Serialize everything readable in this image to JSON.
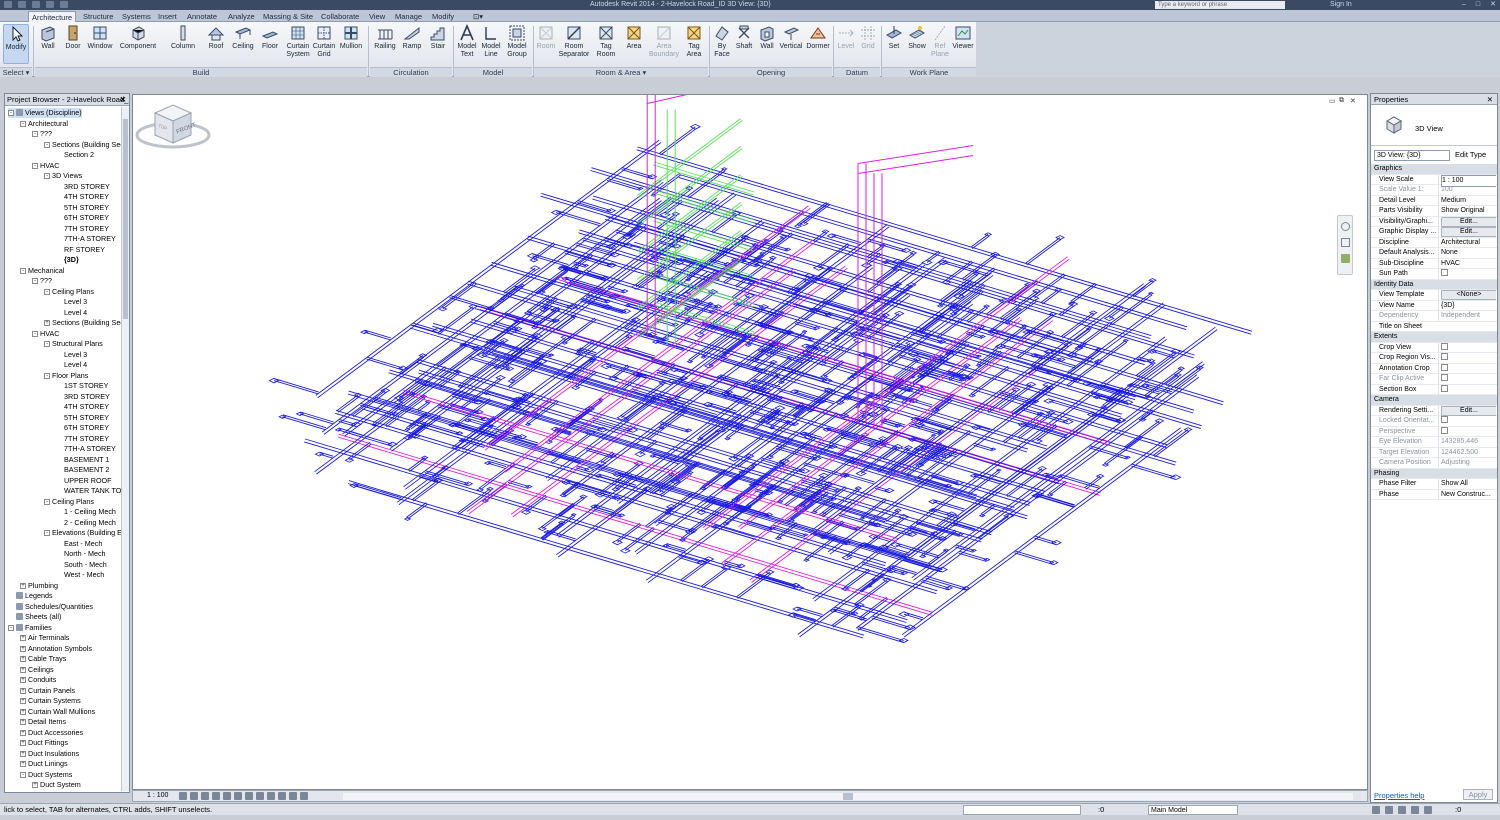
{
  "titlebar": {
    "doc_title": "Autodesk Revit 2014 - 2-Havelock Road_ID 3D View: {3D}",
    "search_placeholder": "Type a keyword or phrase",
    "signin": "Sign In",
    "win_min": "–",
    "win_max": "□",
    "win_close": "✕"
  },
  "ribbon_tabs": [
    "Architecture",
    "Structure",
    "Systems",
    "Insert",
    "Annotate",
    "Analyze",
    "Massing & Site",
    "Collaborate",
    "View",
    "Manage",
    "Modify"
  ],
  "ribbon_tab_extra": "⊡▾",
  "ribbon": {
    "modify": "Modify",
    "select": "Select ▾",
    "build_label": "Build",
    "circulation_label": "Circulation",
    "model_label": "Model",
    "room_area_label": "Room & Area ▾",
    "opening_label": "Opening",
    "datum_label": "Datum",
    "work_plane_label": "Work Plane",
    "buttons": {
      "wall": "Wall",
      "door": "Door",
      "window": "Window",
      "component": "Component",
      "column": "Column",
      "roof": "Roof",
      "ceiling": "Ceiling",
      "floor": "Floor",
      "curtain_system_1": "Curtain",
      "curtain_system_2": "System",
      "curtain_grid_1": "Curtain",
      "curtain_grid_2": "Grid",
      "mullion": "Mullion",
      "railing": "Railing",
      "ramp": "Ramp",
      "stair": "Stair",
      "model_text_1": "Model",
      "model_text_2": "Text",
      "model_line_1": "Model",
      "model_line_2": "Line",
      "model_group_1": "Model",
      "model_group_2": "Group",
      "room": "Room",
      "room_separator_1": "Room",
      "room_separator_2": "Separator",
      "tag_room_1": "Tag",
      "tag_room_2": "Room",
      "area": "Area",
      "area_boundary_1": "Area",
      "area_boundary_2": "Boundary",
      "tag_area_1": "Tag",
      "tag_area_2": "Area",
      "by_face_1": "By",
      "by_face_2": "Face",
      "shaft": "Shaft",
      "wall_opening": "Wall",
      "vertical": "Vertical",
      "dormer": "Dormer",
      "level": "Level",
      "grid": "Grid",
      "set": "Set",
      "show": "Show",
      "ref_plane_1": "Ref",
      "ref_plane_2": "Plane",
      "viewer": "Viewer"
    }
  },
  "browser": {
    "title": "Project Browser - 2-Havelock Road_...",
    "close": "✕",
    "nodes": [
      {
        "label": "Views (Discipline)",
        "depth": 0,
        "exp": "-",
        "sel": true,
        "icon": true
      },
      {
        "label": "Architectural",
        "depth": 1,
        "exp": "-"
      },
      {
        "label": "???",
        "depth": 2,
        "exp": "-"
      },
      {
        "label": "Sections (Building Sec",
        "depth": 3,
        "exp": "-"
      },
      {
        "label": "Section 2",
        "depth": 4,
        "exp": ""
      },
      {
        "label": "HVAC",
        "depth": 2,
        "exp": "-"
      },
      {
        "label": "3D Views",
        "depth": 3,
        "exp": "-"
      },
      {
        "label": "3RD STOREY",
        "depth": 4,
        "exp": ""
      },
      {
        "label": "4TH STOREY",
        "depth": 4,
        "exp": ""
      },
      {
        "label": "5TH STOREY",
        "depth": 4,
        "exp": ""
      },
      {
        "label": "6TH STOREY",
        "depth": 4,
        "exp": ""
      },
      {
        "label": "7TH STOREY",
        "depth": 4,
        "exp": ""
      },
      {
        "label": "7TH-A STOREY",
        "depth": 4,
        "exp": ""
      },
      {
        "label": "RF STOREY",
        "depth": 4,
        "exp": ""
      },
      {
        "label": "{3D}",
        "depth": 4,
        "exp": "",
        "bold": true
      },
      {
        "label": "Mechanical",
        "depth": 1,
        "exp": "-"
      },
      {
        "label": "???",
        "depth": 2,
        "exp": "-"
      },
      {
        "label": "Ceiling Plans",
        "depth": 3,
        "exp": "-"
      },
      {
        "label": "Level 3",
        "depth": 4,
        "exp": ""
      },
      {
        "label": "Level 4",
        "depth": 4,
        "exp": ""
      },
      {
        "label": "Sections (Building Sec",
        "depth": 3,
        "exp": "+"
      },
      {
        "label": "HVAC",
        "depth": 2,
        "exp": "-"
      },
      {
        "label": "Structural Plans",
        "depth": 3,
        "exp": "-"
      },
      {
        "label": "Level 3",
        "depth": 4,
        "exp": ""
      },
      {
        "label": "Level 4",
        "depth": 4,
        "exp": ""
      },
      {
        "label": "Floor Plans",
        "depth": 3,
        "exp": "-"
      },
      {
        "label": "1ST STOREY",
        "depth": 4,
        "exp": ""
      },
      {
        "label": "3RD STOREY",
        "depth": 4,
        "exp": ""
      },
      {
        "label": "4TH STOREY",
        "depth": 4,
        "exp": ""
      },
      {
        "label": "5TH STOREY",
        "depth": 4,
        "exp": ""
      },
      {
        "label": "6TH STOREY",
        "depth": 4,
        "exp": ""
      },
      {
        "label": "7TH STOREY",
        "depth": 4,
        "exp": ""
      },
      {
        "label": "7TH-A STOREY",
        "depth": 4,
        "exp": ""
      },
      {
        "label": "BASEMENT 1",
        "depth": 4,
        "exp": ""
      },
      {
        "label": "BASEMENT 2",
        "depth": 4,
        "exp": ""
      },
      {
        "label": "UPPER ROOF",
        "depth": 4,
        "exp": ""
      },
      {
        "label": "WATER TANK TOP",
        "depth": 4,
        "exp": ""
      },
      {
        "label": "Ceiling Plans",
        "depth": 3,
        "exp": "-"
      },
      {
        "label": "1 - Ceiling Mech",
        "depth": 4,
        "exp": ""
      },
      {
        "label": "2 - Ceiling Mech",
        "depth": 4,
        "exp": ""
      },
      {
        "label": "Elevations (Building E",
        "depth": 3,
        "exp": "-"
      },
      {
        "label": "East - Mech",
        "depth": 4,
        "exp": ""
      },
      {
        "label": "North - Mech",
        "depth": 4,
        "exp": ""
      },
      {
        "label": "South - Mech",
        "depth": 4,
        "exp": ""
      },
      {
        "label": "West - Mech",
        "depth": 4,
        "exp": ""
      },
      {
        "label": "Plumbing",
        "depth": 1,
        "exp": "+"
      },
      {
        "label": "Legends",
        "depth": 0,
        "exp": "",
        "icon": true
      },
      {
        "label": "Schedules/Quantities",
        "depth": 0,
        "exp": "",
        "icon": true
      },
      {
        "label": "Sheets (all)",
        "depth": 0,
        "exp": "",
        "icon": true
      },
      {
        "label": "Families",
        "depth": 0,
        "exp": "-",
        "icon": true
      },
      {
        "label": "Air Terminals",
        "depth": 1,
        "exp": "+"
      },
      {
        "label": "Annotation Symbols",
        "depth": 1,
        "exp": "+"
      },
      {
        "label": "Cable Trays",
        "depth": 1,
        "exp": "+"
      },
      {
        "label": "Ceilings",
        "depth": 1,
        "exp": "+"
      },
      {
        "label": "Conduits",
        "depth": 1,
        "exp": "+"
      },
      {
        "label": "Curtain Panels",
        "depth": 1,
        "exp": "+"
      },
      {
        "label": "Curtain Systems",
        "depth": 1,
        "exp": "+"
      },
      {
        "label": "Curtain Wall Mullions",
        "depth": 1,
        "exp": "+"
      },
      {
        "label": "Detail Items",
        "depth": 1,
        "exp": "+"
      },
      {
        "label": "Duct Accessories",
        "depth": 1,
        "exp": "+"
      },
      {
        "label": "Duct Fittings",
        "depth": 1,
        "exp": "+"
      },
      {
        "label": "Duct Insulations",
        "depth": 1,
        "exp": "+"
      },
      {
        "label": "Duct Linings",
        "depth": 1,
        "exp": "+"
      },
      {
        "label": "Duct Systems",
        "depth": 1,
        "exp": "-"
      },
      {
        "label": "Duct System",
        "depth": 2,
        "exp": "+"
      }
    ]
  },
  "viewcube": {
    "face": "FRONT",
    "top": "TOP"
  },
  "viewbar": {
    "scale": "1 : 100"
  },
  "properties": {
    "title": "Properties",
    "close": "✕",
    "type_name": "3D View",
    "instance_filter": "3D View: {3D}",
    "edit_type": "Edit Type",
    "rows": [
      {
        "k": "Graphics",
        "sec": true
      },
      {
        "k": "View Scale",
        "v": "1 : 100",
        "input": true
      },
      {
        "k": "Scale Value  1:",
        "v": "100",
        "grey": true
      },
      {
        "k": "Detail Level",
        "v": "Medium"
      },
      {
        "k": "Parts Visibility",
        "v": "Show Original"
      },
      {
        "k": "Visibility/Graphi...",
        "v": "Edit...",
        "btn": true
      },
      {
        "k": "Graphic Display ...",
        "v": "Edit...",
        "btn": true
      },
      {
        "k": "Discipline",
        "v": "Architectural"
      },
      {
        "k": "Default Analysis...",
        "v": "None"
      },
      {
        "k": "Sub-Discipline",
        "v": "HVAC"
      },
      {
        "k": "Sun Path",
        "cb": true
      },
      {
        "k": "Identity Data",
        "sec": true
      },
      {
        "k": "View Template",
        "v": "<None>",
        "btn": true
      },
      {
        "k": "View Name",
        "v": "{3D}"
      },
      {
        "k": "Dependency",
        "v": "Independent",
        "grey": true
      },
      {
        "k": "Title on Sheet",
        "v": ""
      },
      {
        "k": "Extents",
        "sec": true
      },
      {
        "k": "Crop View",
        "cb": true
      },
      {
        "k": "Crop Region Vis...",
        "cb": true
      },
      {
        "k": "Annotation Crop",
        "cb": true
      },
      {
        "k": "Far Clip Active",
        "cb": true,
        "grey": true
      },
      {
        "k": "Section Box",
        "cb": true
      },
      {
        "k": "Camera",
        "sec": true
      },
      {
        "k": "Rendering Setti...",
        "v": "Edit...",
        "btn": true
      },
      {
        "k": "Locked Orientat...",
        "cb": true,
        "grey": true
      },
      {
        "k": "Perspective",
        "cb": true,
        "grey": true
      },
      {
        "k": "Eye Elevation",
        "v": "143285.446",
        "grey": true
      },
      {
        "k": "Target Elevation",
        "v": "124462.500",
        "grey": true
      },
      {
        "k": "Camera Position",
        "v": "Adjusting",
        "grey": true
      },
      {
        "k": "Phasing",
        "sec": true
      },
      {
        "k": "Phase Filter",
        "v": "Show All"
      },
      {
        "k": "Phase",
        "v": "New Construc..."
      }
    ],
    "help": "Properties help",
    "apply": "Apply"
  },
  "statusbar": {
    "message": "lick to select, TAB for alternates, CTRL adds, SHIFT unselects.",
    "zero": ":0",
    "model": "Main Model",
    "filter": ":0"
  },
  "colors": {
    "duct_blue": "#1a1adf",
    "duct_magenta": "#e01ee0",
    "duct_green": "#5be05b"
  }
}
